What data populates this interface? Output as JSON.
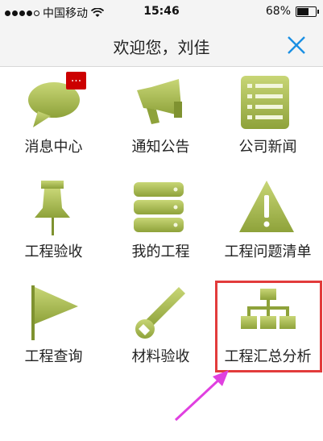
{
  "status_bar": {
    "carrier": "中国移动",
    "time": "15:46",
    "battery": "68%",
    "battery_level": 0.68
  },
  "header": {
    "title": "欢迎您，刘佳",
    "close_icon": "close-icon"
  },
  "menu": [
    {
      "label": "消息中心",
      "icon": "speech-bubble-icon",
      "badge": "..."
    },
    {
      "label": "通知公告",
      "icon": "megaphone-icon"
    },
    {
      "label": "公司新闻",
      "icon": "list-document-icon"
    },
    {
      "label": "工程验收",
      "icon": "pushpin-icon"
    },
    {
      "label": "我的工程",
      "icon": "database-stack-icon"
    },
    {
      "label": "工程问题清单",
      "icon": "warning-triangle-icon"
    },
    {
      "label": "工程查询",
      "icon": "flag-icon"
    },
    {
      "label": "材料验收",
      "icon": "wrench-icon"
    },
    {
      "label": "工程汇总分析",
      "icon": "org-chart-icon"
    }
  ],
  "colors": {
    "icon_green": "#9aae3e",
    "icon_green_light": "#c5d46e",
    "close_blue": "#1a8fe3",
    "highlight_red": "#e23b3b",
    "arrow_magenta": "#e040e0",
    "badge_red": "#cc0000"
  }
}
